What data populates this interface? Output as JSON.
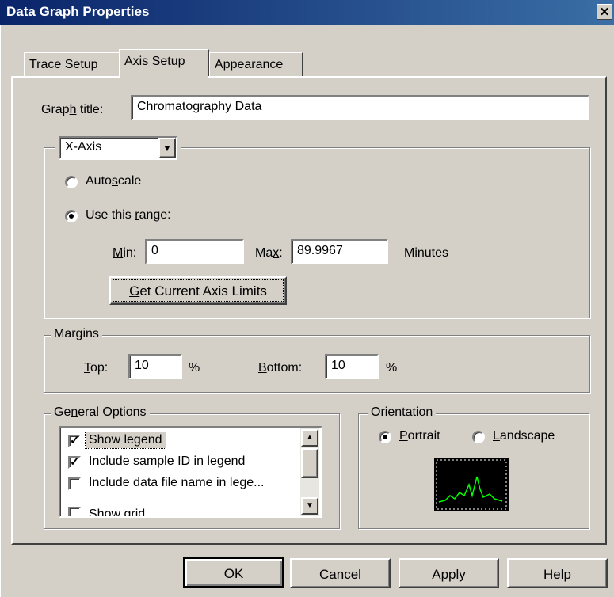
{
  "window": {
    "title": "Data Graph Properties",
    "close_glyph": "✕"
  },
  "tabs": [
    {
      "label": "Trace Setup",
      "active": false
    },
    {
      "label": "Axis Setup",
      "active": true
    },
    {
      "label": "Appearance",
      "active": false
    }
  ],
  "graph_title": {
    "label_pre": "Grap",
    "label_u": "h",
    "label_post": " title:",
    "value": "Chromatography Data"
  },
  "axis": {
    "selected": "X-Axis",
    "autoscale": {
      "pre": "Auto",
      "u": "s",
      "post": "cale",
      "checked": false
    },
    "use_range": {
      "pre": "Use this ",
      "u": "r",
      "post": "ange:",
      "checked": true
    },
    "min": {
      "u": "M",
      "post": "in:",
      "value": "0"
    },
    "max": {
      "pre": "Ma",
      "u": "x",
      "post": ":",
      "value": "89.9967"
    },
    "units": "Minutes",
    "get_limits_button": {
      "u": "G",
      "post": "et Current Axis Limits"
    }
  },
  "margins": {
    "title": "Margins",
    "top": {
      "u": "T",
      "post": "op:",
      "value": "10",
      "unit": "%"
    },
    "bottom": {
      "u": "B",
      "post": "ottom:",
      "value": "10",
      "unit": "%"
    }
  },
  "general_options": {
    "title_pre": "Ge",
    "title_u": "n",
    "title_post": "eral Options",
    "items": [
      {
        "label": "Show legend",
        "checked": true
      },
      {
        "label": "Include sample ID in legend",
        "checked": true
      },
      {
        "label": "Include data file name in lege...",
        "checked": false
      },
      {
        "label": "Show grid",
        "checked": false
      }
    ]
  },
  "orientation": {
    "title": "Orientation",
    "portrait": {
      "u": "P",
      "post": "ortrait",
      "checked": true
    },
    "landscape": {
      "u": "L",
      "post": "andscape",
      "checked": false
    },
    "preview_color": "#00ff00"
  },
  "buttons": {
    "ok": {
      "label": "OK"
    },
    "cancel": {
      "label": "Cancel"
    },
    "apply": {
      "u": "A",
      "post": "pply"
    },
    "help": {
      "label": "Help"
    }
  }
}
